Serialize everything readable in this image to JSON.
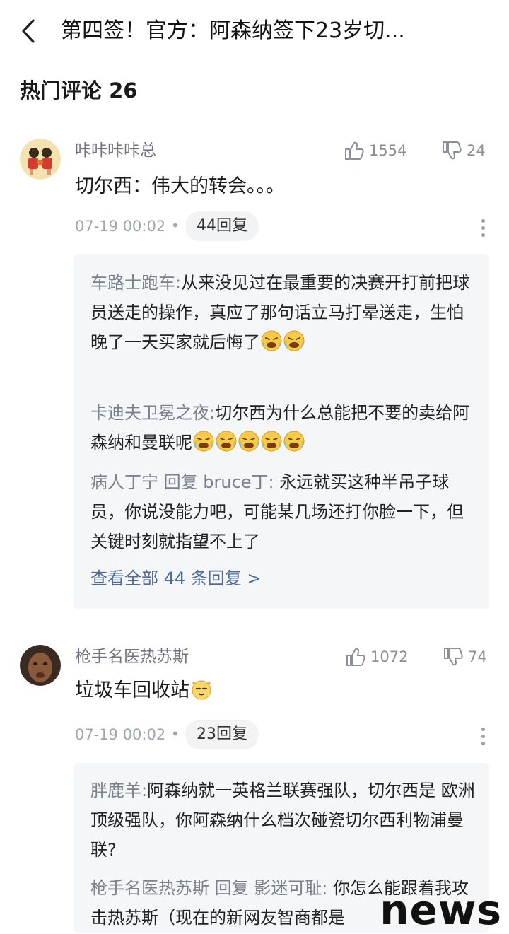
{
  "header": {
    "title": "第四签！官方：阿森纳签下23岁切..."
  },
  "section": {
    "title": "热门评论 26"
  },
  "comments": [
    {
      "username": "咔咔咔咔总",
      "likes": "1554",
      "dislikes": "24",
      "content": "切尔西：伟大的转会。。。",
      "time": "07-19 00:02",
      "reply_count": "44回复",
      "replies": [
        {
          "name": "车路士跑车:",
          "text": "从来没见过在最重要的决赛开打前把球员送走的操作，真应了那句话立马打晕送走，生怕晚了一天买家就后悔了"
        },
        {
          "name": "卡迪夫卫冕之夜:",
          "text": "切尔西为什么总能把不要的卖给阿森纳和曼联呢"
        },
        {
          "name": "病人丁宁",
          "connector": " 回复 ",
          "target": "bruce丁:",
          "text": " 永远就买这种半吊子球员，你说没能力吧，可能某几场还打你脸一下，但关键时刻就指望不上了"
        }
      ],
      "view_all": "查看全部 44 条回复 >"
    },
    {
      "username": "枪手名医热苏斯",
      "likes": "1072",
      "dislikes": "74",
      "content": "垃圾车回收站",
      "time": "07-19 00:02",
      "reply_count": "23回复",
      "replies": [
        {
          "name": "胖鹿羊:",
          "text": "阿森纳就一英格兰联赛强队，切尔西是 欧洲顶级强队，你阿森纳什么档次碰瓷切尔西利物浦曼联?"
        },
        {
          "name": "枪手名医热苏斯",
          "connector": " 回复 ",
          "target": "影迷可耻:",
          "text": " 你怎么能跟着我攻击热苏斯（现在的新网友智商都是"
        }
      ]
    }
  ],
  "watermark": "news",
  "colors": {
    "username": "#6e7481",
    "link": "#4f6b9a",
    "reply_bg": "#f5f6f8"
  },
  "icons": {
    "back": "chevron-left-icon",
    "like": "thumbs-up-icon",
    "dislike": "thumbs-down-icon",
    "more": "more-vertical-icon",
    "emoji_cry": "crying-laugh-emoji",
    "emoji_cat": "smug-cat-emoji"
  }
}
